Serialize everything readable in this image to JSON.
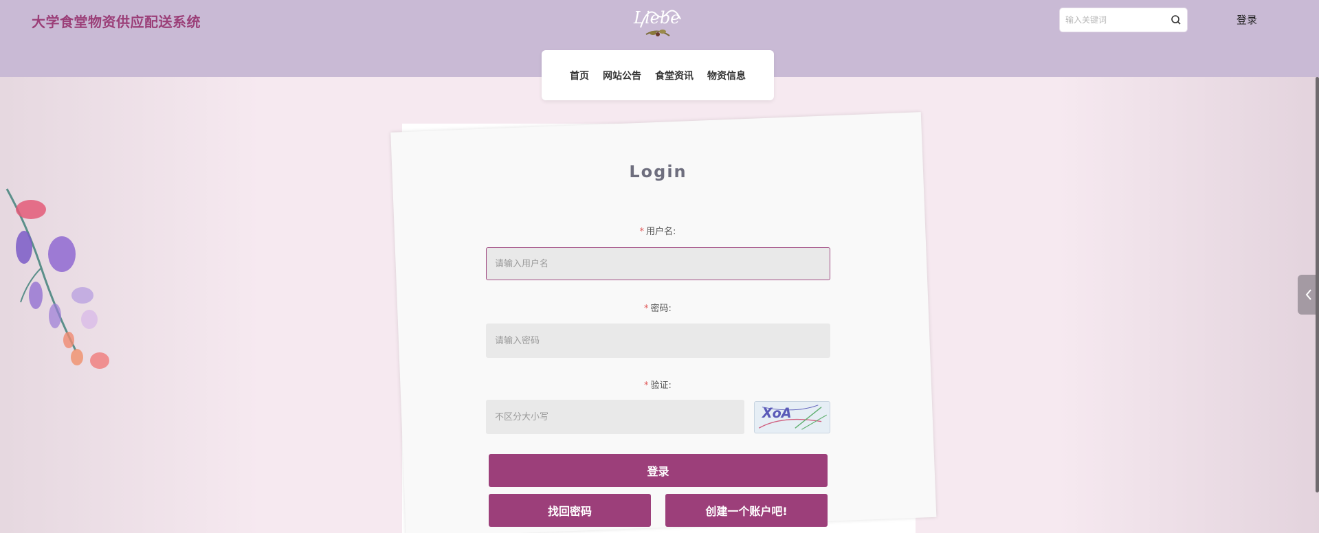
{
  "header": {
    "site_title": "大学食堂物资供应配送系统",
    "logo_text": "Liebe",
    "search_placeholder": "输入关键词",
    "login_link": "登录"
  },
  "nav": {
    "items": [
      {
        "label": "首页"
      },
      {
        "label": "网站公告"
      },
      {
        "label": "食堂资讯"
      },
      {
        "label": "物资信息"
      }
    ]
  },
  "form": {
    "title": "Login",
    "required_mark": "*",
    "username_label": "用户名:",
    "username_placeholder": "请输入用户名",
    "password_label": "密码:",
    "password_placeholder": "请输入密码",
    "verify_label": "验证:",
    "verify_placeholder": "不区分大小写",
    "captcha_text": "XoA",
    "login_button": "登录",
    "recover_button": "找回密码",
    "register_button": "创建一个账户吧!"
  },
  "colors": {
    "header_bg": "#c9bad5",
    "brand": "#9b3f78",
    "page_bg": "#f6e9f0",
    "button": "#9c3f7a"
  }
}
